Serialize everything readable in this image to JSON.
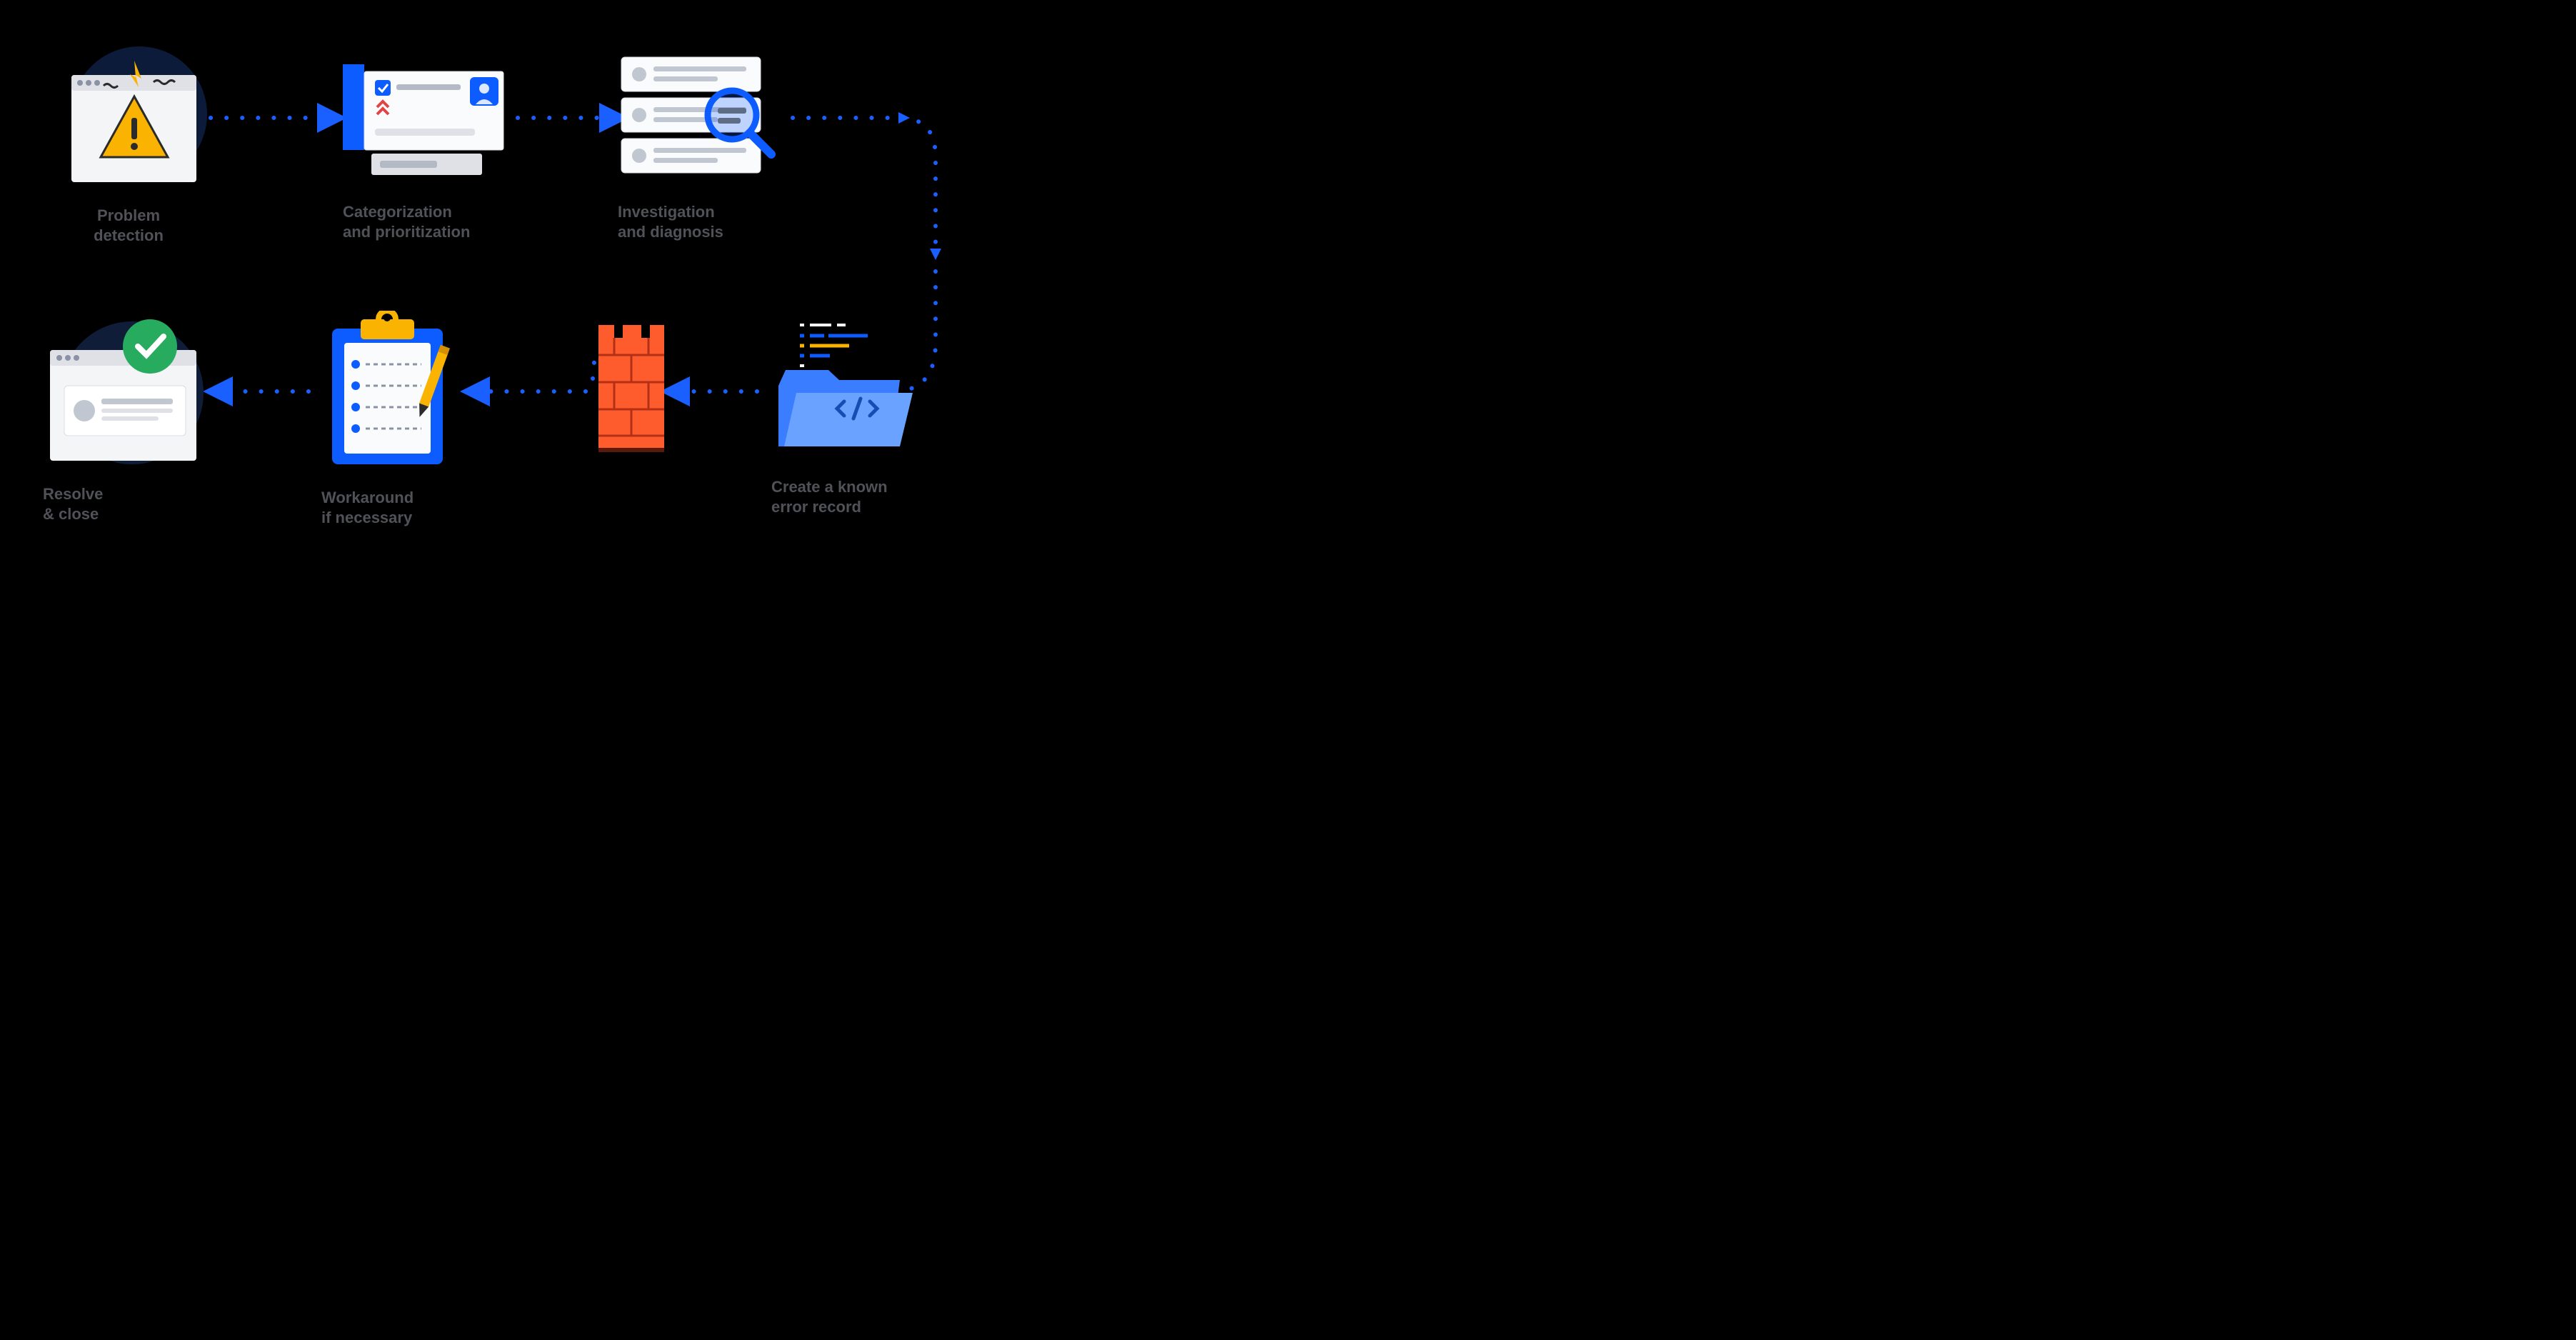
{
  "steps": {
    "detect": {
      "line1": "Problem",
      "line2": "detection"
    },
    "categorize": {
      "line1": "Categorization",
      "line2": "and prioritization"
    },
    "investigate": {
      "line1": "Investigation",
      "line2": "and diagnosis"
    },
    "record": {
      "line1": "Create a known",
      "line2": "error record"
    },
    "workaround": {
      "line1": "Workaround",
      "line2": "if necessary"
    },
    "resolve": {
      "line1": "Resolve",
      "line2": "& close"
    }
  },
  "colors": {
    "blue": "#1a5fff",
    "label": "#505258"
  }
}
